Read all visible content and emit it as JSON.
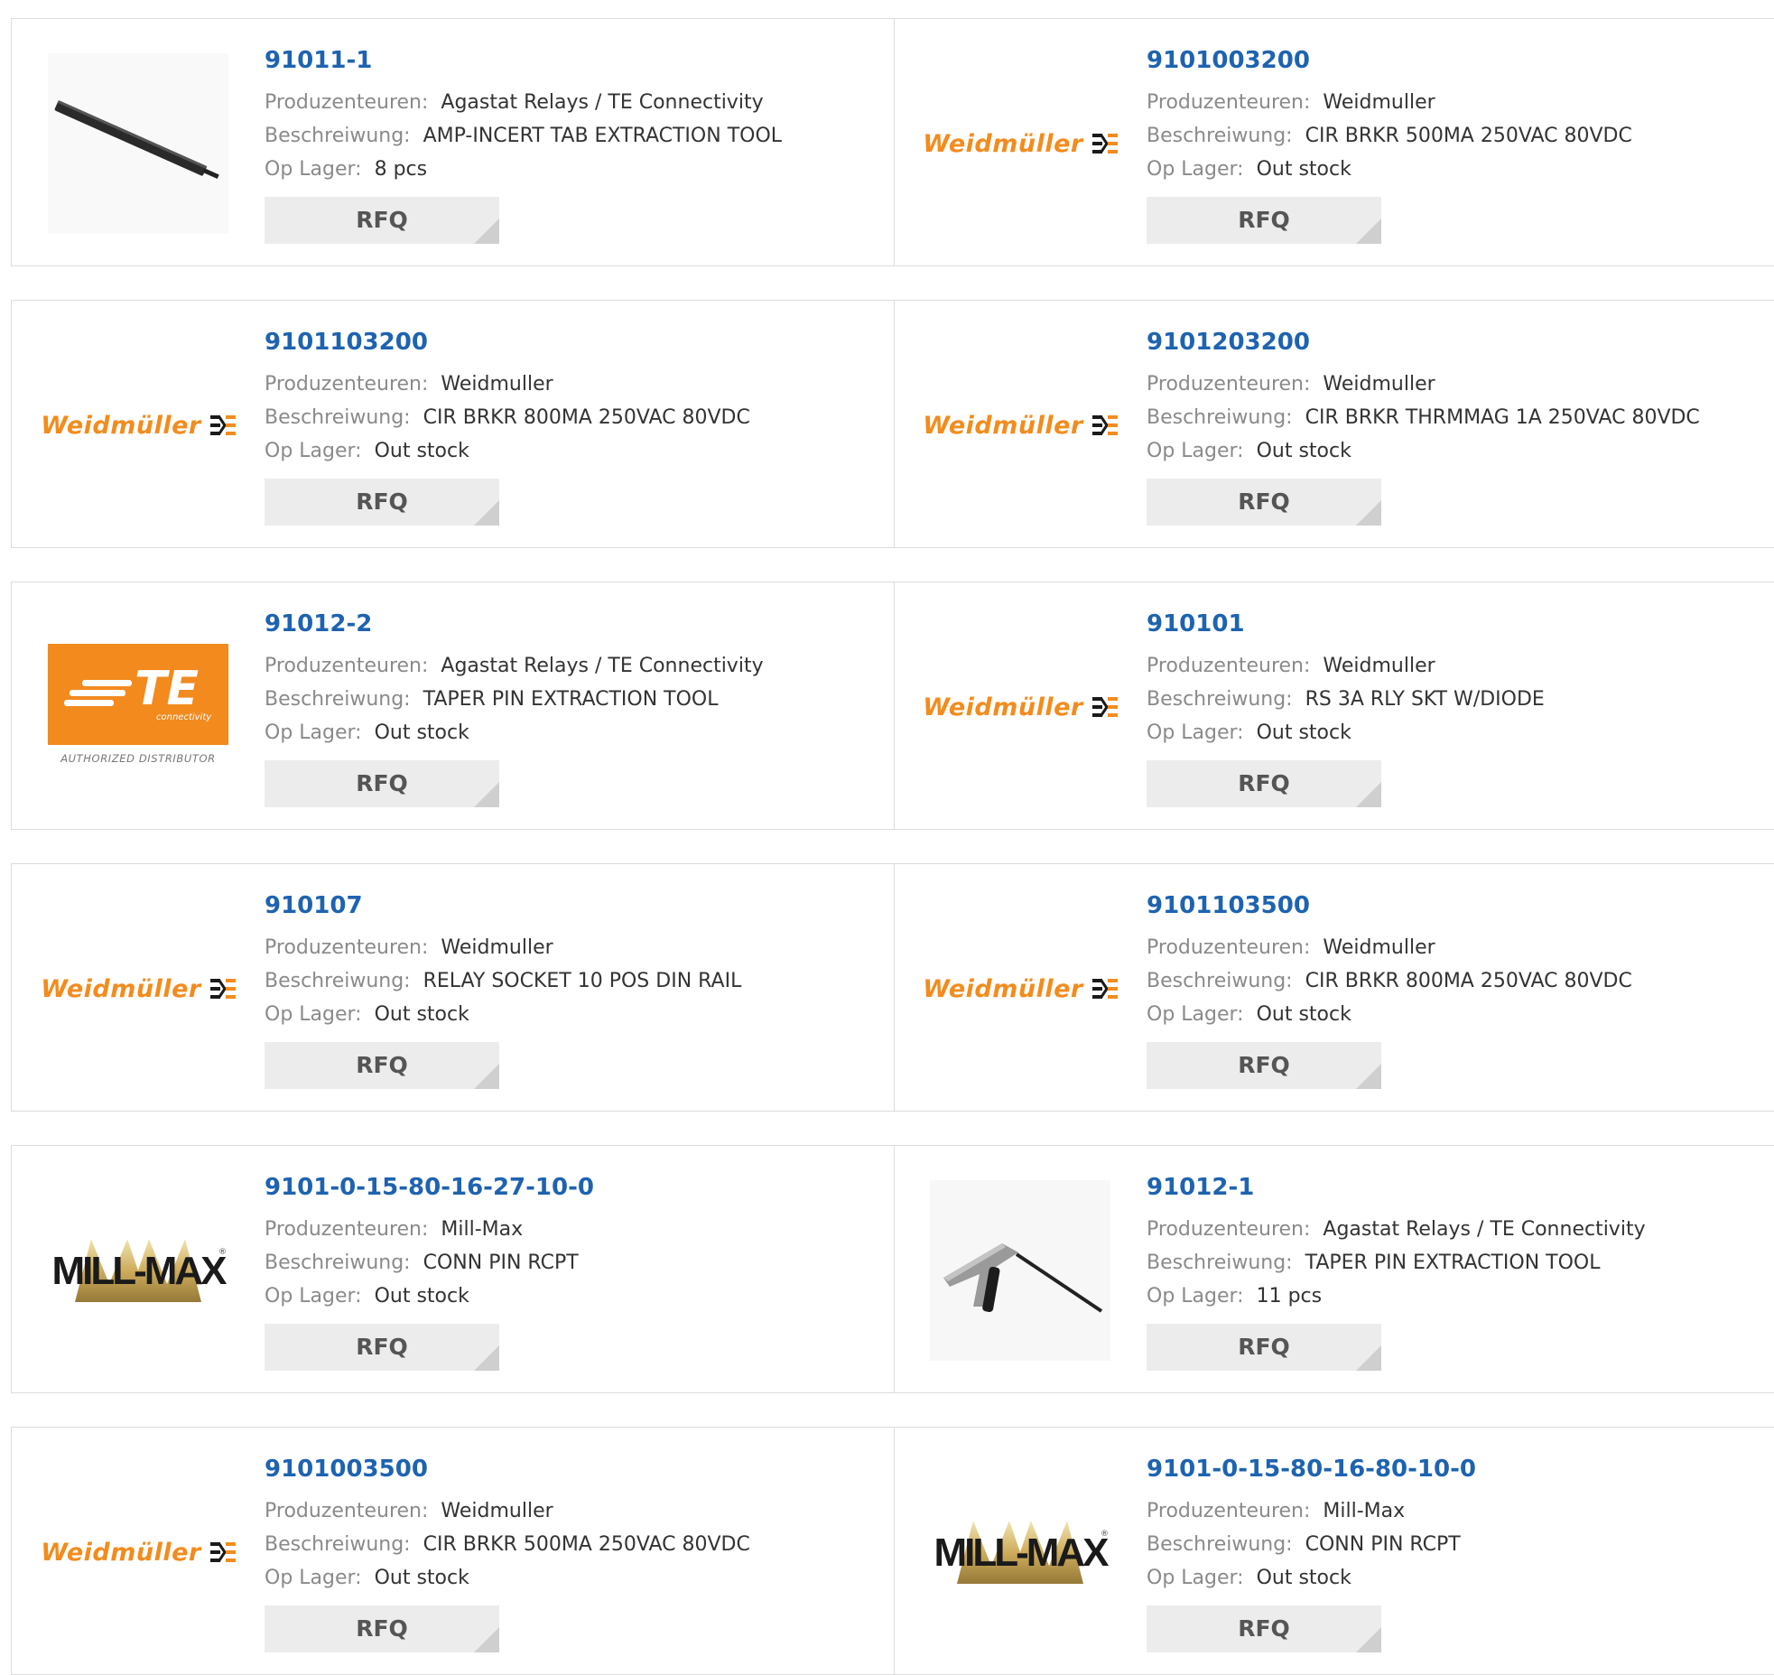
{
  "labels": {
    "manufacturer": "Produzenteuren:",
    "description": "Beschreiwung:",
    "stock": "Op Lager:",
    "rfq": "RFQ"
  },
  "colors": {
    "part_number": "#1e63b0",
    "weidmuller_orange": "#f28c1e",
    "te_orange": "#f28a1e"
  },
  "products": [
    {
      "pn": "91011-1",
      "manufacturer": "Agastat Relays / TE Connectivity",
      "description": "AMP-INCERT TAB EXTRACTION TOOL",
      "stock": "8 pcs",
      "image": "extraction-tool-bar-photo"
    },
    {
      "pn": "9101003200",
      "manufacturer": "Weidmuller",
      "description": "CIR BRKR 500MA 250VAC 80VDC",
      "stock": "Out stock",
      "image": "weidmuller-logo"
    },
    {
      "pn": "9101103200",
      "manufacturer": "Weidmuller",
      "description": "CIR BRKR 800MA 250VAC 80VDC",
      "stock": "Out stock",
      "image": "weidmuller-logo"
    },
    {
      "pn": "9101203200",
      "manufacturer": "Weidmuller",
      "description": "CIR BRKR THRMMAG 1A 250VAC 80VDC",
      "stock": "Out stock",
      "image": "weidmuller-logo"
    },
    {
      "pn": "91012-2",
      "manufacturer": "Agastat Relays / TE Connectivity",
      "description": "TAPER PIN EXTRACTION TOOL",
      "stock": "Out stock",
      "image": "te-connectivity-logo"
    },
    {
      "pn": "910101",
      "manufacturer": "Weidmuller",
      "description": "RS 3A RLY SKT W/DIODE",
      "stock": "Out stock",
      "image": "weidmuller-logo"
    },
    {
      "pn": "910107",
      "manufacturer": "Weidmuller",
      "description": "RELAY SOCKET 10 POS DIN RAIL",
      "stock": "Out stock",
      "image": "weidmuller-logo"
    },
    {
      "pn": "9101103500",
      "manufacturer": "Weidmuller",
      "description": "CIR BRKR 800MA 250VAC 80VDC",
      "stock": "Out stock",
      "image": "weidmuller-logo"
    },
    {
      "pn": "9101-0-15-80-16-27-10-0",
      "manufacturer": "Mill-Max",
      "description": "CONN PIN RCPT",
      "stock": "Out stock",
      "image": "mill-max-logo"
    },
    {
      "pn": "91012-1",
      "manufacturer": "Agastat Relays / TE Connectivity",
      "description": "TAPER PIN EXTRACTION TOOL",
      "stock": "11 pcs",
      "image": "pin-extraction-tool-photo"
    },
    {
      "pn": "9101003500",
      "manufacturer": "Weidmuller",
      "description": "CIR BRKR 500MA 250VAC 80VDC",
      "stock": "Out stock",
      "image": "weidmuller-logo"
    },
    {
      "pn": "9101-0-15-80-16-80-10-0",
      "manufacturer": "Mill-Max",
      "description": "CONN PIN RCPT",
      "stock": "Out stock",
      "image": "mill-max-logo"
    }
  ],
  "logos": {
    "weidmuller": "Weidmüller",
    "te_word": "TE",
    "te_sub": "connectivity",
    "te_auth": "AUTHORIZED DISTRIBUTOR",
    "millmax": "MILL-MAX",
    "millmax_reg": "®"
  }
}
